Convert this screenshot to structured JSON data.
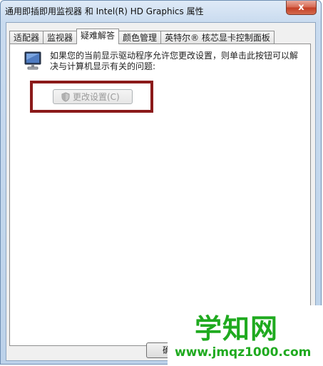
{
  "window": {
    "title": "通用即插即用监视器 和 Intel(R) HD Graphics 属性",
    "close_label": "x"
  },
  "tabs": [
    {
      "label": "适配器"
    },
    {
      "label": "监视器"
    },
    {
      "label": "疑难解答",
      "active": true
    },
    {
      "label": "颜色管理"
    },
    {
      "label": "英特尔® 核芯显卡控制面板"
    }
  ],
  "troubleshoot": {
    "description": "如果您的当前显示驱动程序允许您更改设置，则单击此按钮可以解决与计算机显示有关的问题:",
    "change_button": "更改设置(C)"
  },
  "footer": {
    "ok_label": "确"
  },
  "watermark": {
    "title": "学知网",
    "url": "www.jmqz1000.com"
  },
  "colors": {
    "highlight_border": "#8b1a1a",
    "watermark_green": "#1faa1f"
  }
}
